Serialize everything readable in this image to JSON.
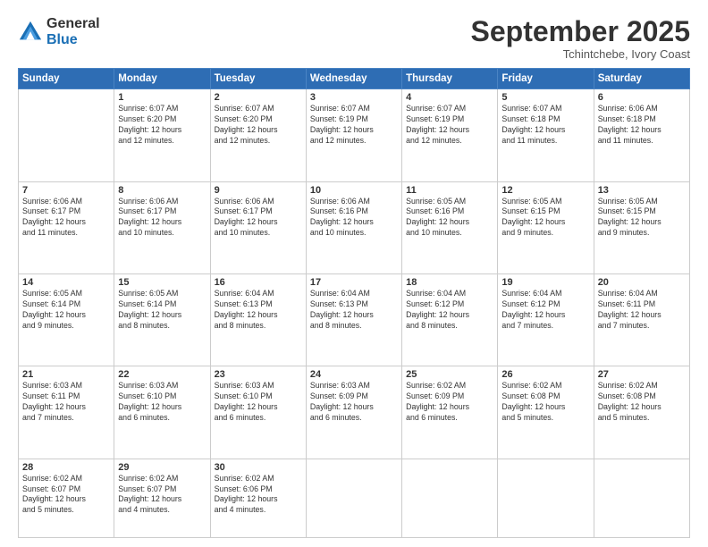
{
  "logo": {
    "general": "General",
    "blue": "Blue"
  },
  "header": {
    "month": "September 2025",
    "location": "Tchintchebe, Ivory Coast"
  },
  "weekdays": [
    "Sunday",
    "Monday",
    "Tuesday",
    "Wednesday",
    "Thursday",
    "Friday",
    "Saturday"
  ],
  "weeks": [
    [
      {
        "day": "",
        "info": ""
      },
      {
        "day": "1",
        "info": "Sunrise: 6:07 AM\nSunset: 6:20 PM\nDaylight: 12 hours\nand 12 minutes."
      },
      {
        "day": "2",
        "info": "Sunrise: 6:07 AM\nSunset: 6:20 PM\nDaylight: 12 hours\nand 12 minutes."
      },
      {
        "day": "3",
        "info": "Sunrise: 6:07 AM\nSunset: 6:19 PM\nDaylight: 12 hours\nand 12 minutes."
      },
      {
        "day": "4",
        "info": "Sunrise: 6:07 AM\nSunset: 6:19 PM\nDaylight: 12 hours\nand 12 minutes."
      },
      {
        "day": "5",
        "info": "Sunrise: 6:07 AM\nSunset: 6:18 PM\nDaylight: 12 hours\nand 11 minutes."
      },
      {
        "day": "6",
        "info": "Sunrise: 6:06 AM\nSunset: 6:18 PM\nDaylight: 12 hours\nand 11 minutes."
      }
    ],
    [
      {
        "day": "7",
        "info": "Sunrise: 6:06 AM\nSunset: 6:17 PM\nDaylight: 12 hours\nand 11 minutes."
      },
      {
        "day": "8",
        "info": "Sunrise: 6:06 AM\nSunset: 6:17 PM\nDaylight: 12 hours\nand 10 minutes."
      },
      {
        "day": "9",
        "info": "Sunrise: 6:06 AM\nSunset: 6:17 PM\nDaylight: 12 hours\nand 10 minutes."
      },
      {
        "day": "10",
        "info": "Sunrise: 6:06 AM\nSunset: 6:16 PM\nDaylight: 12 hours\nand 10 minutes."
      },
      {
        "day": "11",
        "info": "Sunrise: 6:05 AM\nSunset: 6:16 PM\nDaylight: 12 hours\nand 10 minutes."
      },
      {
        "day": "12",
        "info": "Sunrise: 6:05 AM\nSunset: 6:15 PM\nDaylight: 12 hours\nand 9 minutes."
      },
      {
        "day": "13",
        "info": "Sunrise: 6:05 AM\nSunset: 6:15 PM\nDaylight: 12 hours\nand 9 minutes."
      }
    ],
    [
      {
        "day": "14",
        "info": "Sunrise: 6:05 AM\nSunset: 6:14 PM\nDaylight: 12 hours\nand 9 minutes."
      },
      {
        "day": "15",
        "info": "Sunrise: 6:05 AM\nSunset: 6:14 PM\nDaylight: 12 hours\nand 8 minutes."
      },
      {
        "day": "16",
        "info": "Sunrise: 6:04 AM\nSunset: 6:13 PM\nDaylight: 12 hours\nand 8 minutes."
      },
      {
        "day": "17",
        "info": "Sunrise: 6:04 AM\nSunset: 6:13 PM\nDaylight: 12 hours\nand 8 minutes."
      },
      {
        "day": "18",
        "info": "Sunrise: 6:04 AM\nSunset: 6:12 PM\nDaylight: 12 hours\nand 8 minutes."
      },
      {
        "day": "19",
        "info": "Sunrise: 6:04 AM\nSunset: 6:12 PM\nDaylight: 12 hours\nand 7 minutes."
      },
      {
        "day": "20",
        "info": "Sunrise: 6:04 AM\nSunset: 6:11 PM\nDaylight: 12 hours\nand 7 minutes."
      }
    ],
    [
      {
        "day": "21",
        "info": "Sunrise: 6:03 AM\nSunset: 6:11 PM\nDaylight: 12 hours\nand 7 minutes."
      },
      {
        "day": "22",
        "info": "Sunrise: 6:03 AM\nSunset: 6:10 PM\nDaylight: 12 hours\nand 6 minutes."
      },
      {
        "day": "23",
        "info": "Sunrise: 6:03 AM\nSunset: 6:10 PM\nDaylight: 12 hours\nand 6 minutes."
      },
      {
        "day": "24",
        "info": "Sunrise: 6:03 AM\nSunset: 6:09 PM\nDaylight: 12 hours\nand 6 minutes."
      },
      {
        "day": "25",
        "info": "Sunrise: 6:02 AM\nSunset: 6:09 PM\nDaylight: 12 hours\nand 6 minutes."
      },
      {
        "day": "26",
        "info": "Sunrise: 6:02 AM\nSunset: 6:08 PM\nDaylight: 12 hours\nand 5 minutes."
      },
      {
        "day": "27",
        "info": "Sunrise: 6:02 AM\nSunset: 6:08 PM\nDaylight: 12 hours\nand 5 minutes."
      }
    ],
    [
      {
        "day": "28",
        "info": "Sunrise: 6:02 AM\nSunset: 6:07 PM\nDaylight: 12 hours\nand 5 minutes."
      },
      {
        "day": "29",
        "info": "Sunrise: 6:02 AM\nSunset: 6:07 PM\nDaylight: 12 hours\nand 4 minutes."
      },
      {
        "day": "30",
        "info": "Sunrise: 6:02 AM\nSunset: 6:06 PM\nDaylight: 12 hours\nand 4 minutes."
      },
      {
        "day": "",
        "info": ""
      },
      {
        "day": "",
        "info": ""
      },
      {
        "day": "",
        "info": ""
      },
      {
        "day": "",
        "info": ""
      }
    ]
  ]
}
